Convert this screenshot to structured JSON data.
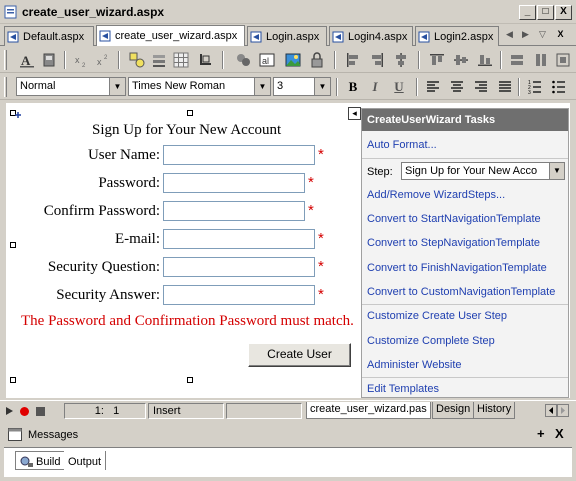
{
  "window": {
    "title": "create_user_wizard.aspx",
    "controls": {
      "minimize": "_",
      "maximize": "□",
      "close": "X"
    }
  },
  "tabs": [
    {
      "label": "Default.aspx",
      "active": false
    },
    {
      "label": "create_user_wizard.aspx",
      "active": true
    },
    {
      "label": "Login.aspx",
      "active": false
    },
    {
      "label": "Login4.aspx",
      "active": false
    },
    {
      "label": "Login2.aspx",
      "active": false
    }
  ],
  "tab_nav": {
    "prev": "◀",
    "next": "▶",
    "menu": "▽",
    "close": "X"
  },
  "format_toolbar": {
    "block_format": "Normal",
    "font_name": "Times New Roman",
    "font_size": "3",
    "bold": "B",
    "italic": "I",
    "underline": "U"
  },
  "designer": {
    "heading": "Sign Up for Your New Account",
    "fields": [
      {
        "label": "User Name:",
        "required": "*"
      },
      {
        "label": "Password:",
        "required": "*"
      },
      {
        "label": "Confirm Password:",
        "required": "*"
      },
      {
        "label": "E-mail:",
        "required": "*"
      },
      {
        "label": "Security Question:",
        "required": "*"
      },
      {
        "label": "Security Answer:",
        "required": "*"
      }
    ],
    "error_message": "The Password and Confirmation Password must match.",
    "submit_label": "Create User",
    "smart_tag": "◂"
  },
  "task_panel": {
    "title": "CreateUserWizard Tasks",
    "auto_format": "Auto Format...",
    "step_label": "Step:",
    "step_value": "Sign Up for Your New Acco",
    "links_group1": [
      "Add/Remove WizardSteps...",
      "Convert to StartNavigationTemplate",
      "Convert to StepNavigationTemplate",
      "Convert to FinishNavigationTemplate",
      "Convert to CustomNavigationTemplate"
    ],
    "links_group2": [
      "Customize Create User Step",
      "Customize Complete Step",
      "Administer Website"
    ],
    "edit_templates": "Edit Templates"
  },
  "status_bar": {
    "position": "1:   1",
    "mode": "Insert",
    "file_tab": "create_user_wizard.pas",
    "design_tab": "Design",
    "history_tab": "History"
  },
  "messages_panel": {
    "title": "Messages",
    "pin": "+",
    "close": "X",
    "tabs": [
      "Build",
      "Output"
    ]
  },
  "colors": {
    "required": "#d40000",
    "link": "#1f3fb0",
    "panel_header": "#6f6f6f"
  }
}
